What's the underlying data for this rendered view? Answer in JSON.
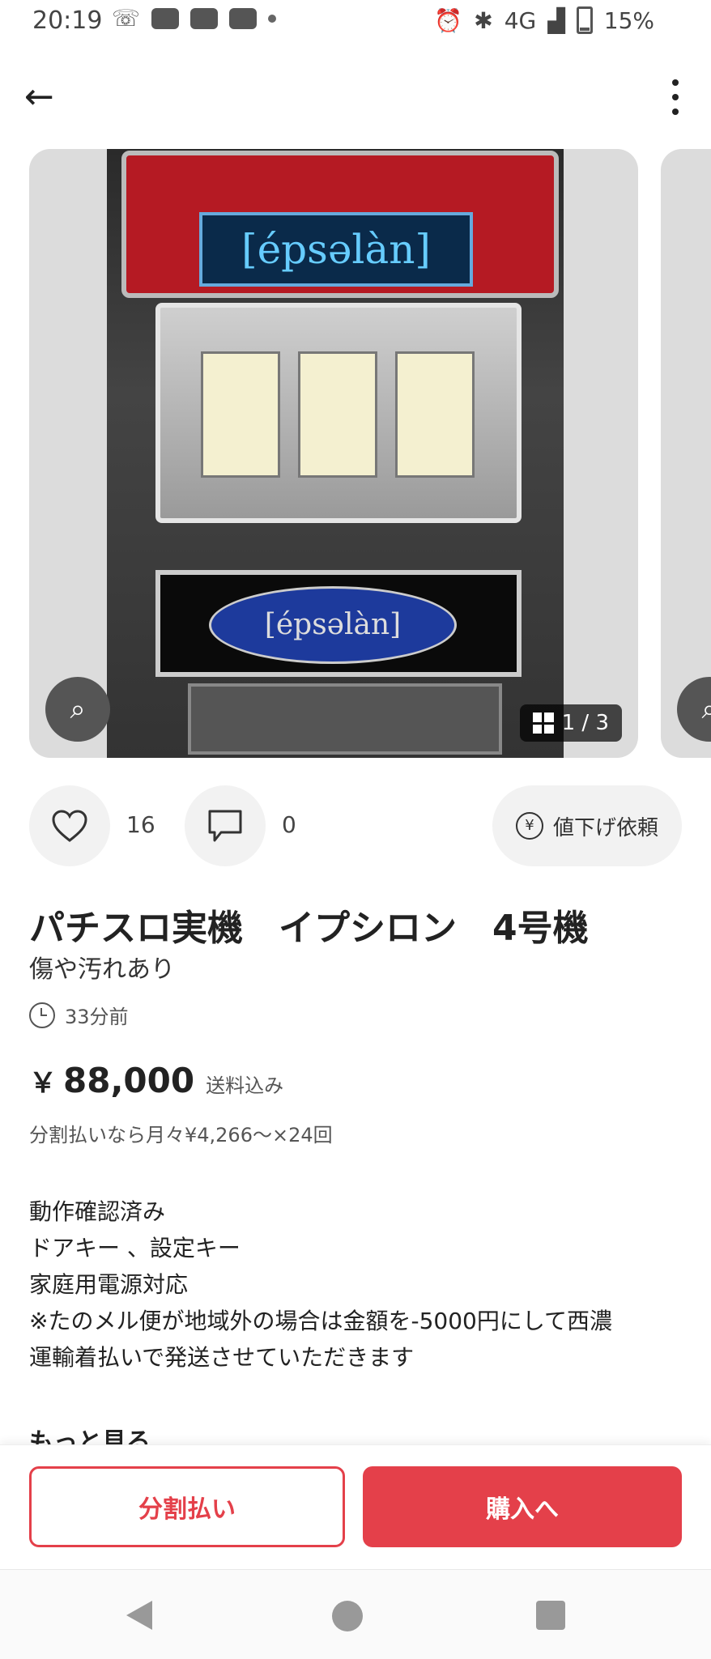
{
  "status_bar": {
    "time": "20:19",
    "network": "4G",
    "battery": "15%"
  },
  "gallery": {
    "counter": "1 / 3",
    "logo_text": "[épsəlàn]"
  },
  "actions": {
    "likes": "16",
    "comments": "0",
    "price_request": "値下げ依頼"
  },
  "product": {
    "title": "パチスロ実機　イプシロン　4号機",
    "condition": "傷や汚れあり",
    "posted": "33分前",
    "currency": "￥",
    "price": "88,000",
    "shipping": "送料込み",
    "installment": "分割払いなら月々¥4,266〜×24回",
    "description": [
      "動作確認済み",
      "ドアキー 、設定キー",
      "家庭用電源対応",
      "※たのメル便が地域外の場合は金額を-5000円にして西濃",
      "運輸着払いで発送させていただきます"
    ],
    "more": "もっと見る"
  },
  "buttons": {
    "installment_pay": "分割払い",
    "buy": "購入へ"
  },
  "colors": {
    "accent": "#e4404a"
  }
}
